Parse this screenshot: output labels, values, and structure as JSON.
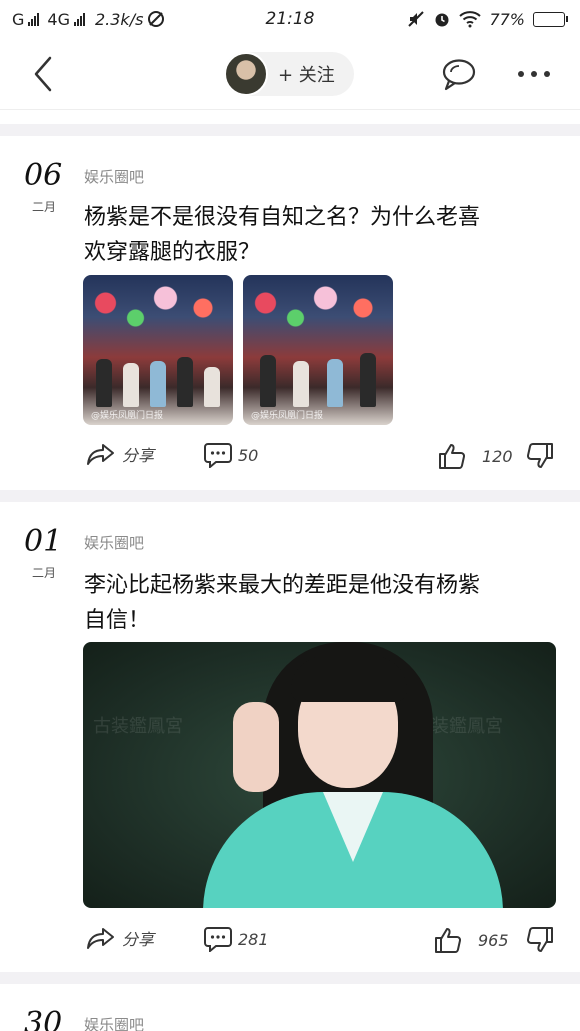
{
  "status_bar": {
    "carrier_left": "G",
    "network": "4G",
    "speed": "2.3k/s",
    "time": "21:18",
    "battery": "77%",
    "battery_level": 0.77
  },
  "header": {
    "follow_label": "+ 关注",
    "icons": [
      "back-arrow-icon",
      "avatar",
      "chat-bubble-icon",
      "more-dots-icon"
    ]
  },
  "posts": [
    {
      "day": "06",
      "month": "二月",
      "forum": "娱乐圈吧",
      "title_line1": "杨紫是不是很没有自知之名？为什么老喜",
      "title_line2": "欢穿露腿的衣服？",
      "image_watermarks": [
        "@娱乐凤凰门日报",
        "@娱乐凤凰门日报"
      ],
      "actions": {
        "share": "分享",
        "comments": "50",
        "likes": "120"
      }
    },
    {
      "day": "01",
      "month": "二月",
      "forum": "娱乐圈吧",
      "title_line1": "李沁比起杨紫来最大的差距是他没有杨紫",
      "title_line2": "自信！",
      "image_watermarks": [
        "古装鑑鳳宮",
        "古装鑑鳳宮"
      ],
      "actions": {
        "share": "分享",
        "comments": "281",
        "likes": "965"
      }
    },
    {
      "day": "30",
      "forum": "娱乐圈吧"
    }
  ]
}
